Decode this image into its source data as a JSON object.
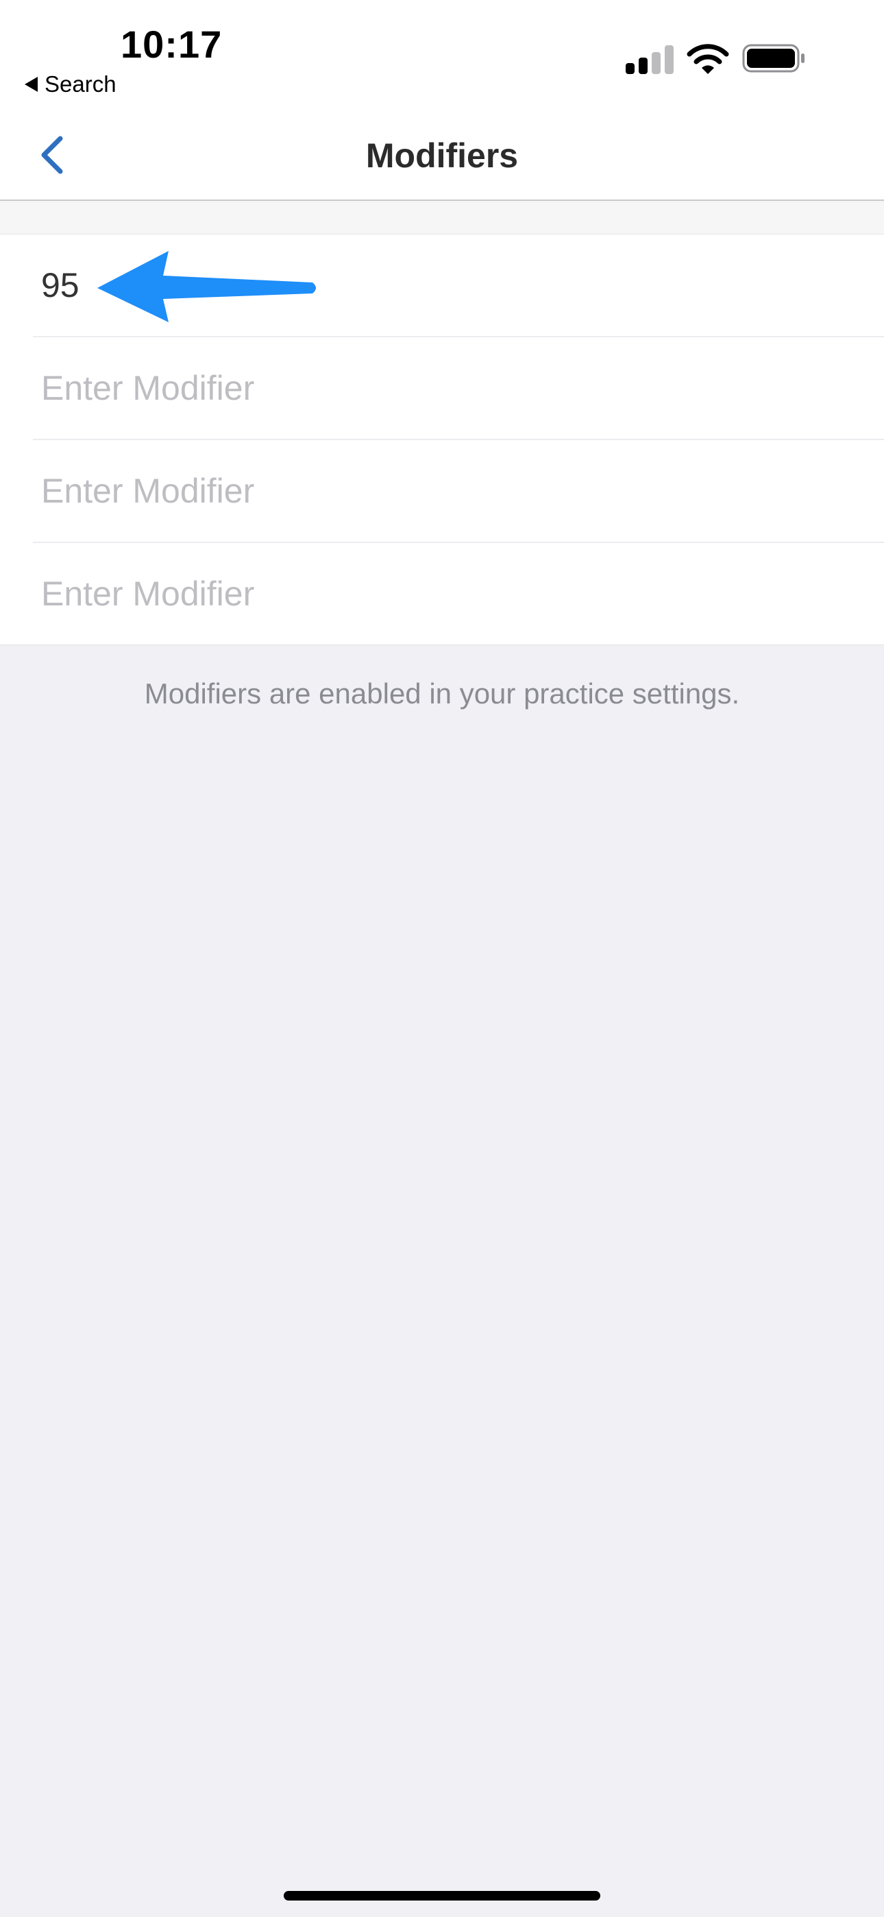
{
  "status_bar": {
    "time": "10:17",
    "back_app_label": "Search",
    "icons": [
      "cellular-signal-icon",
      "wifi-icon",
      "battery-icon"
    ]
  },
  "nav": {
    "title": "Modifiers",
    "back_icon": "chevron-left-icon"
  },
  "modifiers": {
    "fields": [
      {
        "value": "95",
        "placeholder": "Enter Modifier"
      },
      {
        "value": "",
        "placeholder": "Enter Modifier"
      },
      {
        "value": "",
        "placeholder": "Enter Modifier"
      },
      {
        "value": "",
        "placeholder": "Enter Modifier"
      }
    ],
    "footer_note": "Modifiers are enabled in your practice settings."
  },
  "colors": {
    "accent": "#2f6fbf",
    "annotation_arrow": "#1e8ef8",
    "placeholder": "#bdbdc2",
    "background": "#f0f0f5"
  }
}
